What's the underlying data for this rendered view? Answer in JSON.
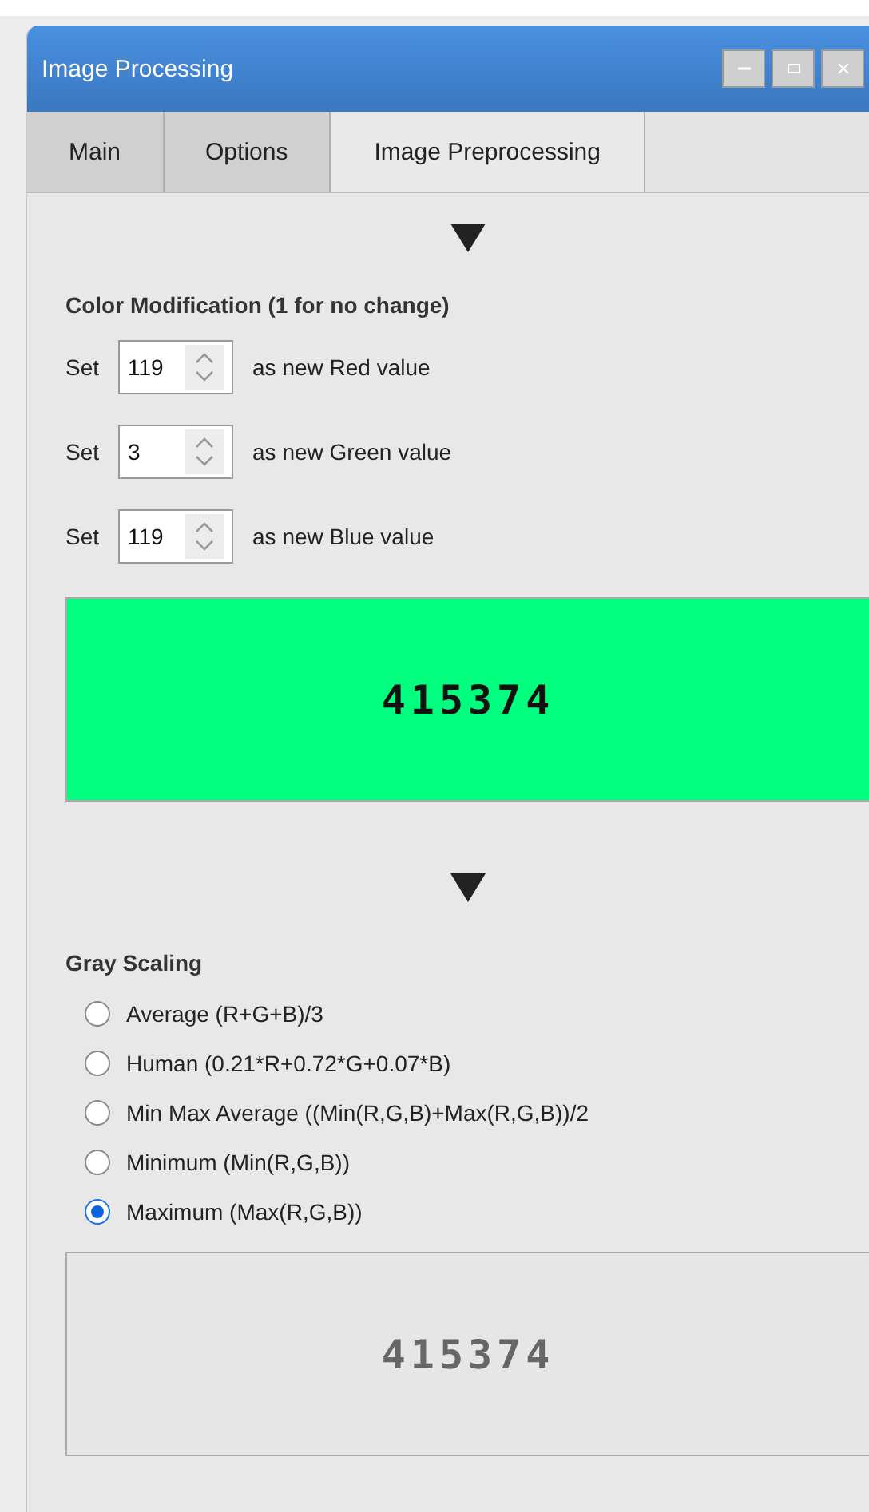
{
  "window": {
    "title": "Image Processing"
  },
  "tabs": [
    {
      "label": "Main",
      "selected": false
    },
    {
      "label": "Options",
      "selected": false
    },
    {
      "label": "Image Preprocessing",
      "selected": true
    }
  ],
  "color_modification": {
    "heading": "Color Modification (1 for no change)",
    "rows": [
      {
        "prefix": "Set",
        "value": "119",
        "suffix": "as new Red value"
      },
      {
        "prefix": "Set",
        "value": "3",
        "suffix": "as new Green value"
      },
      {
        "prefix": "Set",
        "value": "119",
        "suffix": "as new Blue value"
      }
    ],
    "preview": {
      "text": "415374",
      "color": "#00ff7f"
    }
  },
  "gray_scaling": {
    "heading": "Gray Scaling",
    "options": [
      {
        "label": "Average (R+G+B)/3",
        "selected": false
      },
      {
        "label": "Human (0.21*R+0.72*G+0.07*B)",
        "selected": false
      },
      {
        "label": "Min Max Average ((Min(R,G,B)+Max(R,G,B))/2",
        "selected": false
      },
      {
        "label": "Minimum (Min(R,G,B))",
        "selected": false
      },
      {
        "label": "Maximum (Max(R,G,B))",
        "selected": true
      }
    ],
    "preview": {
      "text": "415374"
    }
  }
}
